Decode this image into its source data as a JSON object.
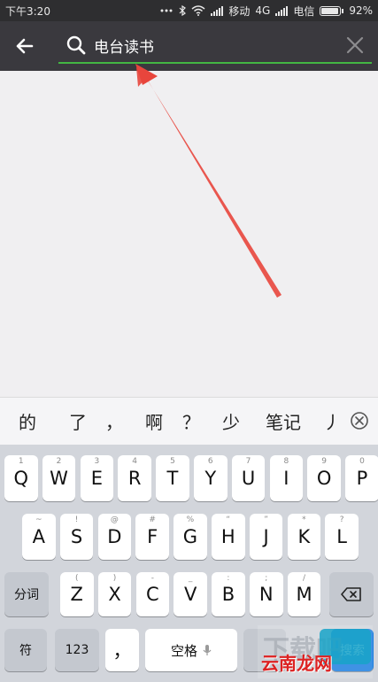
{
  "statusbar": {
    "time": "下午3:20",
    "carrier1": "移动",
    "network": "4G",
    "carrier2": "电信",
    "battery_percent": "92%",
    "battery_level": 0.92
  },
  "header": {
    "search_value": "电台读书",
    "accent_color": "#43b643"
  },
  "candidates": [
    "的",
    "了",
    "，",
    "啊",
    "？",
    "少",
    "笔记",
    "丿"
  ],
  "keyboard": {
    "row1": [
      {
        "k": "Q",
        "s": "1"
      },
      {
        "k": "W",
        "s": "2"
      },
      {
        "k": "E",
        "s": "3"
      },
      {
        "k": "R",
        "s": "4"
      },
      {
        "k": "T",
        "s": "5"
      },
      {
        "k": "Y",
        "s": "6"
      },
      {
        "k": "U",
        "s": "7"
      },
      {
        "k": "I",
        "s": "8"
      },
      {
        "k": "O",
        "s": "9"
      },
      {
        "k": "P",
        "s": "0"
      }
    ],
    "row2": [
      {
        "k": "A",
        "s": "~"
      },
      {
        "k": "S",
        "s": "!"
      },
      {
        "k": "D",
        "s": "@"
      },
      {
        "k": "F",
        "s": "#"
      },
      {
        "k": "G",
        "s": "%"
      },
      {
        "k": "H",
        "s": "“"
      },
      {
        "k": "J",
        "s": "”"
      },
      {
        "k": "K",
        "s": "*"
      },
      {
        "k": "L",
        "s": "?"
      }
    ],
    "row3": [
      {
        "k": "Z",
        "s": "("
      },
      {
        "k": "X",
        "s": ")"
      },
      {
        "k": "C",
        "s": "-"
      },
      {
        "k": "V",
        "s": "_"
      },
      {
        "k": "B",
        "s": ":"
      },
      {
        "k": "N",
        "s": ";"
      },
      {
        "k": "M",
        "s": "/"
      }
    ],
    "fenci": "分词",
    "fu": "符",
    "num": "123",
    "comma": "，",
    "space": "空格",
    "search": "搜索"
  },
  "watermark": {
    "text": "云南龙网"
  },
  "icons": [
    "back-arrow-icon",
    "search-icon",
    "clear-icon",
    "delete-candidate-icon",
    "backspace-icon",
    "microphone-icon",
    "bluetooth-icon",
    "wifi-icon",
    "signal-icon",
    "battery-icon"
  ]
}
